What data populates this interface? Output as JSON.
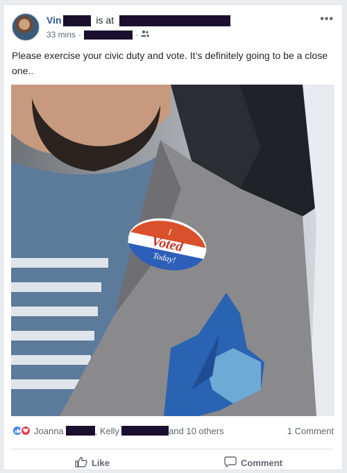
{
  "post": {
    "author_first": "Vin",
    "is_at": "is at",
    "time": "33 mins",
    "dot": "·",
    "text": "Please exercise your civic duty and vote. It’s definitely going to be a close one..",
    "more_label": "•••"
  },
  "photo": {
    "sticker_line1": "I",
    "sticker_line2": "Voted",
    "sticker_line3": "Today!"
  },
  "stats": {
    "name1": "Joanna",
    "name2_prefix": ", Kelly",
    "others": "and 10 others",
    "comments": "1 Comment"
  },
  "actions": {
    "like": "Like",
    "comment": "Comment"
  },
  "icons": {
    "audience": "friends-icon",
    "like": "thumbs-up-icon",
    "comment": "speech-bubble-icon",
    "reaction_like": "like-reaction-icon",
    "reaction_love": "love-reaction-icon"
  },
  "colors": {
    "link": "#365899",
    "like_reaction": "#3b82f6",
    "love_reaction": "#f0384f"
  }
}
